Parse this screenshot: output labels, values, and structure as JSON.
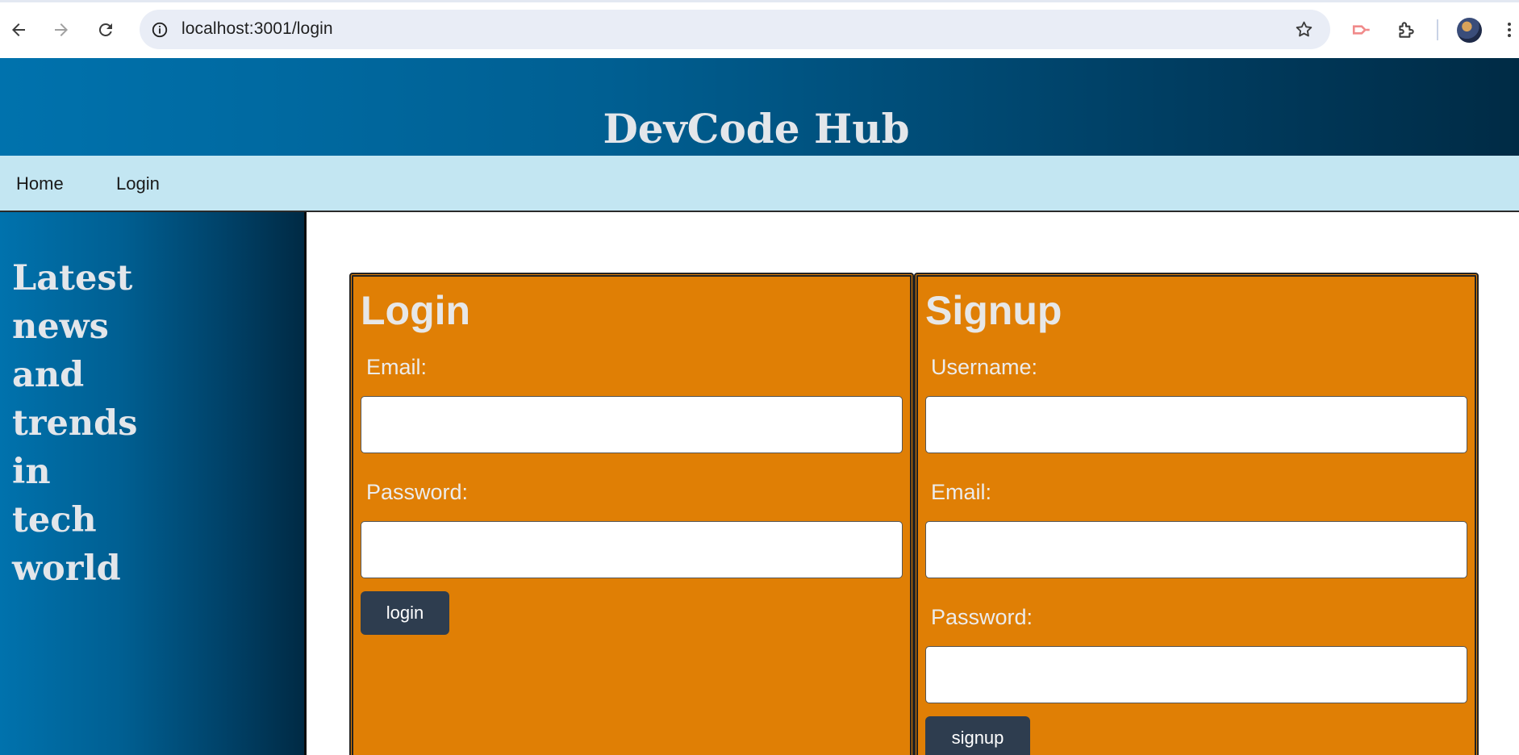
{
  "browser": {
    "url": "localhost:3001/login",
    "icons": {
      "back": "back-arrow-icon",
      "forward": "forward-arrow-icon",
      "reload": "reload-icon",
      "info": "site-info-icon",
      "star": "bookmark-star-icon",
      "extension_pin": "extension-icon",
      "extensions": "puzzle-icon",
      "profile": "avatar",
      "menu": "kebab-menu-icon"
    }
  },
  "header": {
    "title": "DevCode Hub"
  },
  "nav": {
    "items": [
      {
        "label": "Home"
      },
      {
        "label": "Login"
      }
    ]
  },
  "sidebar": {
    "heading": "Latest news and trends in tech world"
  },
  "login_form": {
    "title": "Login",
    "email_label": "Email:",
    "email_value": "",
    "password_label": "Password:",
    "password_value": "",
    "submit_label": "login"
  },
  "signup_form": {
    "title": "Signup",
    "username_label": "Username:",
    "username_value": "",
    "email_label": "Email:",
    "email_value": "",
    "password_label": "Password:",
    "password_value": "",
    "submit_label": "signup"
  },
  "colors": {
    "header_gradient_start": "#0072ad",
    "header_gradient_end": "#002b45",
    "navbar_bg": "#c3e6f2",
    "form_bg": "#e07f05",
    "button_bg": "#2e3d4f",
    "heading_text": "#e3e6ea"
  }
}
